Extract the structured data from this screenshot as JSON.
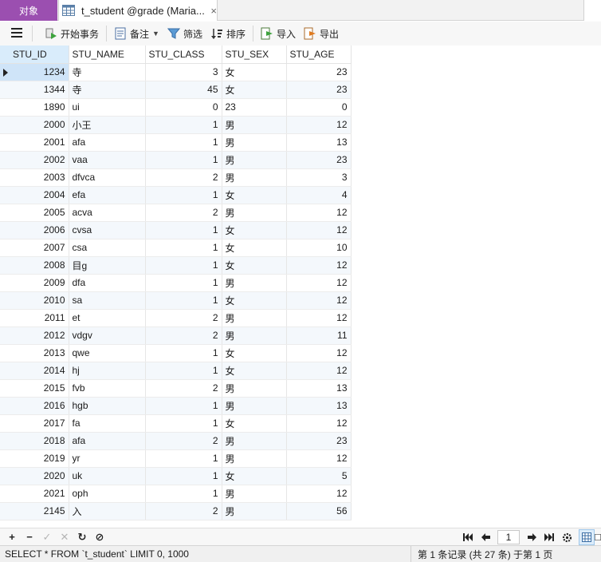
{
  "tabs": {
    "objects_label": "对象",
    "table_tab_label": "t_student @grade (Maria...",
    "close_glyph": "×"
  },
  "toolbar": {
    "begin_transaction": "开始事务",
    "memo": "备注",
    "filter": "筛选",
    "sort": "排序",
    "import": "导入",
    "export": "导出"
  },
  "grid": {
    "columns": [
      "STU_ID",
      "STU_NAME",
      "STU_CLASS",
      "STU_SEX",
      "STU_AGE"
    ],
    "rows": [
      [
        "1234",
        "寺",
        "3",
        "女",
        "23"
      ],
      [
        "1344",
        "寺",
        "45",
        "女",
        "23"
      ],
      [
        "1890",
        "ui",
        "0",
        "23",
        "0"
      ],
      [
        "2000",
        "小王",
        "1",
        "男",
        "12"
      ],
      [
        "2001",
        "afa",
        "1",
        "男",
        "13"
      ],
      [
        "2002",
        "vaa",
        "1",
        "男",
        "23"
      ],
      [
        "2003",
        "dfvca",
        "2",
        "男",
        "3"
      ],
      [
        "2004",
        "efa",
        "1",
        "女",
        "4"
      ],
      [
        "2005",
        "acva",
        "2",
        "男",
        "12"
      ],
      [
        "2006",
        "cvsa",
        "1",
        "女",
        "12"
      ],
      [
        "2007",
        "csa",
        "1",
        "女",
        "10"
      ],
      [
        "2008",
        "目g",
        "1",
        "女",
        "12"
      ],
      [
        "2009",
        "dfa",
        "1",
        "男",
        "12"
      ],
      [
        "2010",
        "sa",
        "1",
        "女",
        "12"
      ],
      [
        "2011",
        "et",
        "2",
        "男",
        "12"
      ],
      [
        "2012",
        "vdgv",
        "2",
        "男",
        "11"
      ],
      [
        "2013",
        "qwe",
        "1",
        "女",
        "12"
      ],
      [
        "2014",
        "hj",
        "1",
        "女",
        "12"
      ],
      [
        "2015",
        "fvb",
        "2",
        "男",
        "13"
      ],
      [
        "2016",
        "hgb",
        "1",
        "男",
        "13"
      ],
      [
        "2017",
        "fa",
        "1",
        "女",
        "12"
      ],
      [
        "2018",
        "afa",
        "2",
        "男",
        "23"
      ],
      [
        "2019",
        "yr",
        "1",
        "男",
        "12"
      ],
      [
        "2020",
        "uk",
        "1",
        "女",
        "5"
      ],
      [
        "2021",
        "oph",
        "1",
        "男",
        "12"
      ],
      [
        "2145",
        "入",
        "2",
        "男",
        "56"
      ]
    ]
  },
  "nav": {
    "add": "+",
    "remove": "−",
    "apply": "✓",
    "discard": "✕",
    "refresh": "↻",
    "stop": "⊘",
    "current_page": "1"
  },
  "status": {
    "sql": "SELECT * FROM `t_student` LIMIT 0, 1000",
    "record_info": "第 1 条记录 (共 27 条) 于第 1 页"
  },
  "colors": {
    "objects_tab": "#9b4fb0",
    "selected_cell": "#cfe4f8",
    "alt_row": "#f4f8fc"
  }
}
